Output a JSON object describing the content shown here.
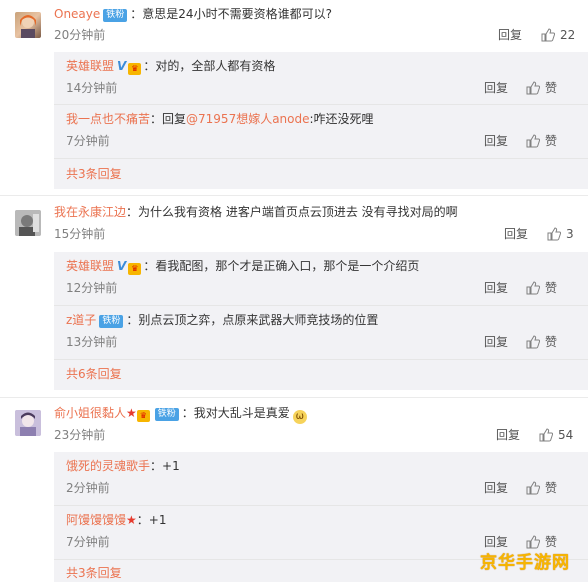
{
  "comments": [
    {
      "user": "Oneaye",
      "badge": "铁粉",
      "text": "：意思是24小时不需要资格谁都可以?",
      "time": "20分钟前",
      "reply_label": "回复",
      "likes": "22",
      "replies": [
        {
          "user": "英雄联盟",
          "text": "：对的，全部人都有资格",
          "time": "14分钟前",
          "reply_label": "回复",
          "like_label": "赞"
        },
        {
          "user": "我一点也不痛苦",
          "text_prefix": "：回复",
          "mention": "@71957想嫁人anode",
          "text": ":咋还没死哩",
          "time": "7分钟前",
          "reply_label": "回复",
          "like_label": "赞"
        }
      ],
      "more": "共3条回复"
    },
    {
      "user": "我在永康江边",
      "text": "：为什么我有资格 进客户端首页点云顶进去 没有寻找对局的啊",
      "time": "15分钟前",
      "reply_label": "回复",
      "likes": "3",
      "replies": [
        {
          "user": "英雄联盟",
          "text": "：看我配图，那个才是正确入口，那个是一个介绍页",
          "time": "12分钟前",
          "reply_label": "回复",
          "like_label": "赞"
        },
        {
          "user": "z道子",
          "badge": "铁粉",
          "text": "：别点云顶之弈，点原来武器大师竞技场的位置",
          "time": "13分钟前",
          "reply_label": "回复",
          "like_label": "赞"
        }
      ],
      "more": "共6条回复"
    },
    {
      "user": "俞小姐很黏人",
      "badge": "铁粉",
      "text": "：我对大乱斗是真爱",
      "time": "23分钟前",
      "reply_label": "回复",
      "likes": "54",
      "replies": [
        {
          "user": "饿死的灵魂歌手",
          "text": "：+1",
          "time": "2分钟前",
          "reply_label": "回复",
          "like_label": "赞"
        },
        {
          "user": "阿馒馒馒馒",
          "text": "：+1",
          "time": "7分钟前",
          "reply_label": "回复",
          "like_label": "赞"
        }
      ],
      "more": "共3条回复"
    }
  ],
  "watermark": "京华手游网",
  "colors": {
    "username": "#eb7350",
    "badge": "#4aa2e5",
    "reply_bg": "#f2f2f5"
  }
}
